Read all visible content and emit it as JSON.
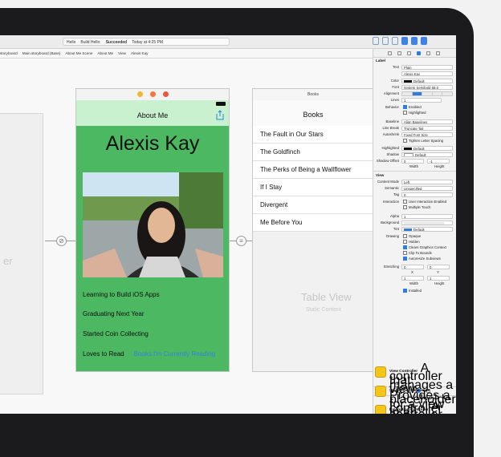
{
  "titlebar": {
    "scheme": "Hello",
    "status_prefix": "Build Hello:",
    "status_result": "Succeeded",
    "status_time": "Today at 4:25 PM"
  },
  "jumpbar": {
    "items": [
      "storyboard",
      "Main.storyboard (Base)",
      "About Me Scene",
      "About Me",
      "View",
      "Alexis Kay"
    ]
  },
  "canvas": {
    "left_scene_label": "er",
    "about_scene": {
      "nav_title": "About Me",
      "name": "Alexis Kay",
      "bio_lines": [
        "Learning to Build iOS Apps",
        "Graduating Next Year",
        "Started Coin Collecting",
        "Loves to Read"
      ],
      "bio_link": "Books I'm Currently Reading"
    },
    "books_scene": {
      "header": "Books",
      "nav_title": "Books",
      "rows": [
        "The Fault in Our Stars",
        "The Goldfinch",
        "The Perks of Being a Wallflower",
        "If I Stay",
        "Divergent",
        "Me Before You"
      ],
      "placeholder_title": "Table View",
      "placeholder_sub": "Static Content"
    },
    "colors": {
      "scene_green": "#4cb862",
      "nav_green": "#c9f0cf",
      "link_blue": "#2e86de"
    }
  },
  "inspector": {
    "label_section": "Label",
    "text_label": "Text",
    "text_value": "Plain",
    "content_value": "Alexis Kay",
    "color_label": "Color",
    "color_value": "Default",
    "font_label": "Font",
    "font_value": "System Semibold 58.0",
    "alignment_label": "Alignment",
    "lines_label": "Lines",
    "lines_value": "1",
    "behavior_label": "Behavior",
    "behavior_enabled": "Enabled",
    "behavior_highlighted": "Highlighted",
    "baseline_label": "Baseline",
    "baseline_value": "Align Baselines",
    "linebreak_label": "Line Break",
    "linebreak_value": "Truncate Tail",
    "autoshrink_label": "Autoshrink",
    "autoshrink_value": "Fixed Font Size",
    "tighten_value": "Tighten Letter Spacing",
    "highlighted_label": "Highlighted",
    "highlighted_value": "Default",
    "shadow_label": "Shadow",
    "shadow_value": "Default",
    "shadow_offset_label": "Shadow Offset",
    "shadow_w": "0",
    "shadow_h": "-1",
    "width_label": "Width",
    "height_label": "Height",
    "view_section": "View",
    "content_mode_label": "Content Mode",
    "content_mode_value": "Left",
    "semantic_label": "Semantic",
    "semantic_value": "Unspecified",
    "tag_label": "Tag",
    "tag_value": "0",
    "interaction_label": "Interaction",
    "interaction_user": "User Interaction Enabled",
    "interaction_multi": "Multiple Touch",
    "alpha_label": "Alpha",
    "alpha_value": "1",
    "background_label": "Background",
    "tint_label": "Tint",
    "tint_value": "Default",
    "drawing_label": "Drawing",
    "drawing_items": [
      "Opaque",
      "Hidden",
      "Clears Graphics Context",
      "Clip To Bounds",
      "Autoresize Subviews"
    ],
    "stretching_label": "Stretching",
    "stretch_x": "0",
    "stretch_y": "0",
    "stretch_w": "1",
    "stretch_h": "1",
    "x_label": "X",
    "y_label": "Y",
    "installed_label": "Installed",
    "library": [
      {
        "title": "View Controller",
        "desc": "A controller that manages a view."
      },
      {
        "title": "Storyboard Reference",
        "desc": "Provides a placeholder for a view controller in an external storyboard."
      },
      {
        "title": "Navigation Controller",
        "desc": "A controller that manages navigation through a hierarchy of views."
      }
    ]
  }
}
